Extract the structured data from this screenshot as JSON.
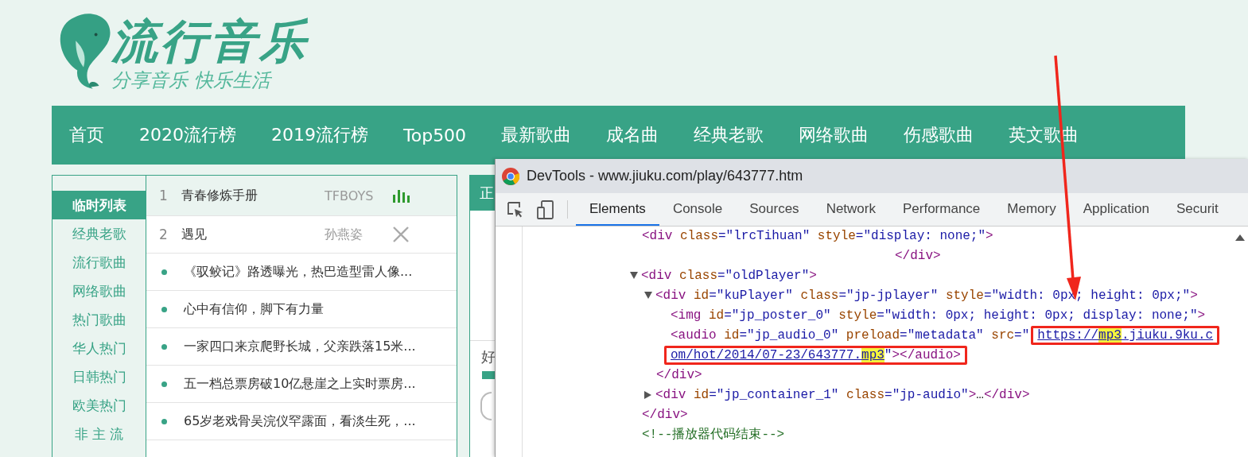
{
  "logo": {
    "title": "流行音乐",
    "slogan": "分享音乐 快乐生活"
  },
  "nav": [
    "首页",
    "2020流行榜",
    "2019流行榜",
    "Top500",
    "最新歌曲",
    "成名曲",
    "经典老歌",
    "网络歌曲",
    "伤感歌曲",
    "英文歌曲"
  ],
  "sidebar": {
    "items": [
      {
        "label": "临时列表",
        "selected": true
      },
      {
        "label": "经典老歌",
        "selected": false
      },
      {
        "label": "流行歌曲",
        "selected": false
      },
      {
        "label": "网络歌曲",
        "selected": false
      },
      {
        "label": "热门歌曲",
        "selected": false
      },
      {
        "label": "华人热门",
        "selected": false
      },
      {
        "label": "日韩热门",
        "selected": false
      },
      {
        "label": "欧美热门",
        "selected": false
      },
      {
        "label": "非 主 流",
        "selected": false
      }
    ]
  },
  "song_list": [
    {
      "kind": "song",
      "number": "1",
      "title": "青春修炼手册",
      "artist": "TFBOYS",
      "playing": true,
      "selected": true
    },
    {
      "kind": "song",
      "number": "2",
      "title": "遇见",
      "artist": "孙燕姿",
      "playing": false,
      "selected": false
    },
    {
      "kind": "news",
      "text": "《驭鲛记》路透曝光，热巴造型雷人像...",
      "selected": false
    },
    {
      "kind": "news",
      "text": "心中有信仰，脚下有力量",
      "selected": false
    },
    {
      "kind": "news",
      "text": "一家四口来京爬野长城，父亲跌落15米...",
      "selected": false
    },
    {
      "kind": "news",
      "text": "五一档总票房破10亿悬崖之上实时票房...",
      "selected": false
    },
    {
      "kind": "news",
      "text": "65岁老戏骨吴浣仪罕露面，看淡生死，...",
      "selected": false
    }
  ],
  "side_panel": {
    "header": "正",
    "label": "好"
  },
  "devtools": {
    "title": "DevTools - www.jiuku.com/play/643777.htm",
    "tabs": [
      {
        "label": "Elements",
        "selected": true
      },
      {
        "label": "Console",
        "selected": false
      },
      {
        "label": "Sources",
        "selected": false
      },
      {
        "label": "Network",
        "selected": false
      },
      {
        "label": "Performance",
        "selected": false
      },
      {
        "label": "Memory",
        "selected": false
      },
      {
        "label": "Application",
        "selected": false
      },
      {
        "label": "Securit",
        "selected": false
      }
    ],
    "dom_tree": [
      {
        "kind": "spaced",
        "lines": [
          [
            {
              "kind": "tag",
              "text": "<div"
            },
            {
              "kind": "attr",
              "text": " class"
            },
            {
              "kind": "value",
              "text": "=\"lrcTihuan\""
            },
            {
              "kind": "attr",
              "text": " style"
            },
            {
              "kind": "value",
              "text": "=\"display: none;\""
            },
            {
              "kind": "tag",
              "text": ">"
            }
          ],
          [
            {
              "kind": "tag",
              "text": "</div>"
            }
          ]
        ]
      },
      {
        "kind": "element",
        "expanded": true,
        "lines": [
          [
            {
              "kind": "tag",
              "text": "<div"
            },
            {
              "kind": "attr",
              "text": " class"
            },
            {
              "kind": "value",
              "text": "=\"oldPlayer\""
            },
            {
              "kind": "tag",
              "text": ">"
            }
          ]
        ],
        "children": [
          {
            "kind": "element",
            "expanded": true,
            "lines": [
              [
                {
                  "kind": "tag",
                  "text": "<div"
                },
                {
                  "kind": "attr",
                  "text": " id"
                },
                {
                  "kind": "value",
                  "text": "=\"kuPlayer\""
                },
                {
                  "kind": "attr",
                  "text": " class"
                },
                {
                  "kind": "value",
                  "text": "=\"jp-jplayer\""
                },
                {
                  "kind": "attr",
                  "text": " style"
                },
                {
                  "kind": "value",
                  "text": "=\"width: 0px; height: 0px;\""
                },
                {
                  "kind": "tag",
                  "text": ">"
                }
              ]
            ],
            "children": [
              {
                "kind": "leaf",
                "lines": [
                  [
                    {
                      "kind": "tag",
                      "text": "<img"
                    },
                    {
                      "kind": "attr",
                      "text": " id"
                    },
                    {
                      "kind": "value",
                      "text": "=\"jp_poster_0\""
                    },
                    {
                      "kind": "attr",
                      "text": " style"
                    },
                    {
                      "kind": "value",
                      "text": "=\"width: 0px; height: 0px; display: none;\""
                    },
                    {
                      "kind": "tag",
                      "text": ">"
                    }
                  ]
                ]
              },
              {
                "kind": "wrapped",
                "lines": [
                  [
                    {
                      "kind": "tag",
                      "text": "<audio"
                    },
                    {
                      "kind": "attr",
                      "text": " id"
                    },
                    {
                      "kind": "value",
                      "text": "=\"jp_audio_0\""
                    },
                    {
                      "kind": "attr",
                      "text": " preload"
                    },
                    {
                      "kind": "value",
                      "text": "=\"metadata\""
                    },
                    {
                      "kind": "attr",
                      "text": " src"
                    },
                    {
                      "kind": "value",
                      "text": "=\""
                    },
                    {
                      "kind": "annotated",
                      "tokens": [
                        {
                          "kind": "link",
                          "parts": [
                            {
                              "text": "https://",
                              "highlighted": false
                            },
                            {
                              "text": "mp3",
                              "highlighted": true
                            },
                            {
                              "text": ".jiuku.9ku.c",
                              "highlighted": false
                            }
                          ]
                        }
                      ]
                    }
                  ],
                  [
                    {
                      "kind": "annotated",
                      "tokens": [
                        {
                          "kind": "link",
                          "parts": [
                            {
                              "text": "om/hot/2014/07-23/643777.",
                              "highlighted": false
                            },
                            {
                              "text": "mp3",
                              "highlighted": true
                            }
                          ]
                        },
                        {
                          "kind": "value",
                          "text": "\""
                        },
                        {
                          "kind": "tag",
                          "text": "></audio>"
                        }
                      ]
                    }
                  ]
                ]
              }
            ],
            "closing": [
              {
                "kind": "tag",
                "text": "</div>"
              }
            ]
          },
          {
            "kind": "element",
            "expanded": false,
            "lines": [
              [
                {
                  "kind": "tag",
                  "text": "<div"
                },
                {
                  "kind": "attr",
                  "text": " id"
                },
                {
                  "kind": "value",
                  "text": "=\"jp_container_1\""
                },
                {
                  "kind": "attr",
                  "text": " class"
                },
                {
                  "kind": "value",
                  "text": "=\"jp-audio\""
                },
                {
                  "kind": "tag",
                  "text": ">"
                },
                {
                  "kind": "text",
                  "text": "…"
                },
                {
                  "kind": "tag",
                  "text": "</div>"
                }
              ]
            ]
          }
        ],
        "closing": [
          {
            "kind": "tag",
            "text": "</div>"
          }
        ]
      },
      {
        "kind": "comment",
        "lines": [
          [
            {
              "kind": "comment",
              "text": "<!--播放器代码结束-->"
            }
          ]
        ]
      }
    ]
  }
}
